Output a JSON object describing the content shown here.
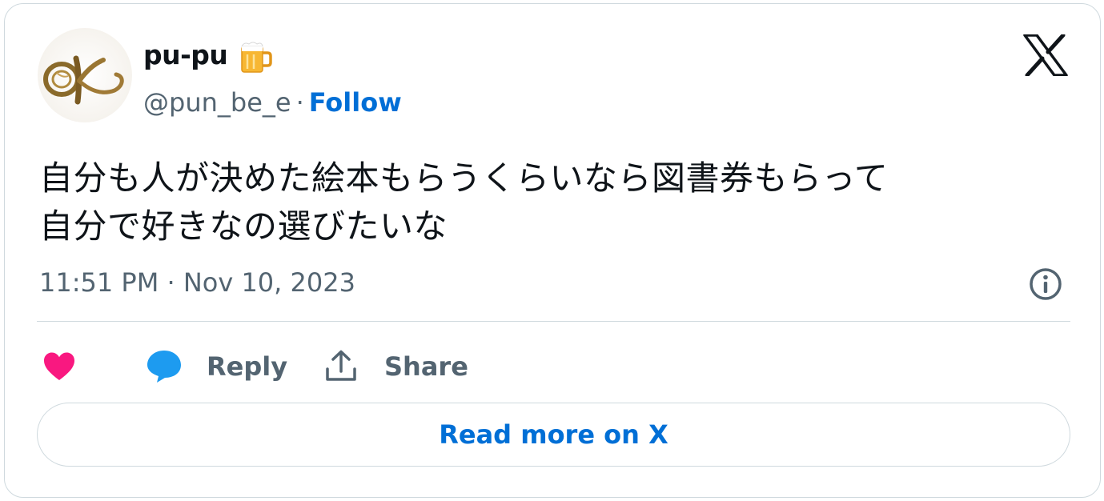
{
  "author": {
    "name": "pu-pu",
    "name_emoji": "beer-mug-icon",
    "handle": "@pun_be_e",
    "separator": "·",
    "follow_label": "Follow"
  },
  "tweet": {
    "text_lines": [
      "自分も人が決めた絵本もらうくらいなら図書券もらって",
      "自分で好きなの選びたいな"
    ],
    "timestamp": "11:51 PM · Nov 10, 2023"
  },
  "actions": {
    "like_icon": "heart-icon",
    "reply_label": "Reply",
    "share_label": "Share"
  },
  "read_more_label": "Read more on X",
  "colors": {
    "link_blue": "#006fd6",
    "secondary_text": "#536471",
    "like_pink": "#f91880",
    "reply_blue": "#1d9bf0",
    "border": "#cfd9de"
  }
}
